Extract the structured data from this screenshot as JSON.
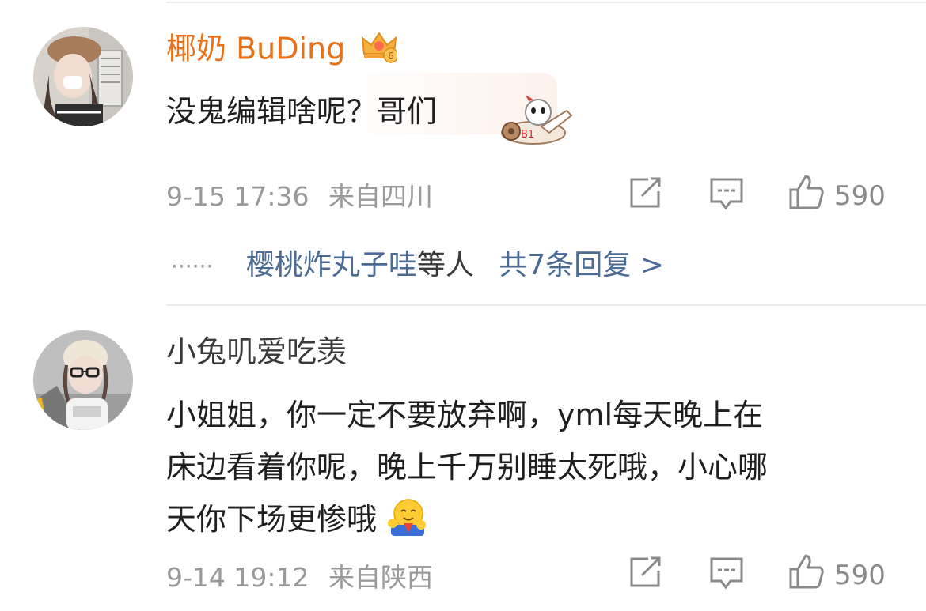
{
  "comments": [
    {
      "user": "椰奶 BuDing",
      "badge_level": "6",
      "text": "没鬼编辑啥呢？哥们",
      "time": "9-15 17:36",
      "location": "来自四川",
      "likes": "590",
      "replies_prefix": "······",
      "replies_who": "樱桃炸丸子哇",
      "replies_etc": "等人",
      "replies_count": "共7条回复 >"
    },
    {
      "user": "小兔叽爱吃羡",
      "text_lines": [
        "小姐姐，你一定不要放弃啊，yml每天晚上在",
        "床边看着你呢，晚上千万别睡太死哦，小心哪",
        "天你下场更惨哦"
      ],
      "time": "9-14 19:12",
      "location": "来自陕西",
      "likes": "590"
    }
  ],
  "colors": {
    "vip_name": "#e8721c",
    "link": "#4b6a94",
    "meta": "#9a9a9a",
    "divider": "#ececec"
  },
  "icons": [
    "crown-badge-icon",
    "sticker-airplane-icon",
    "share-icon",
    "comment-icon",
    "like-icon",
    "hug-emoji-icon"
  ]
}
